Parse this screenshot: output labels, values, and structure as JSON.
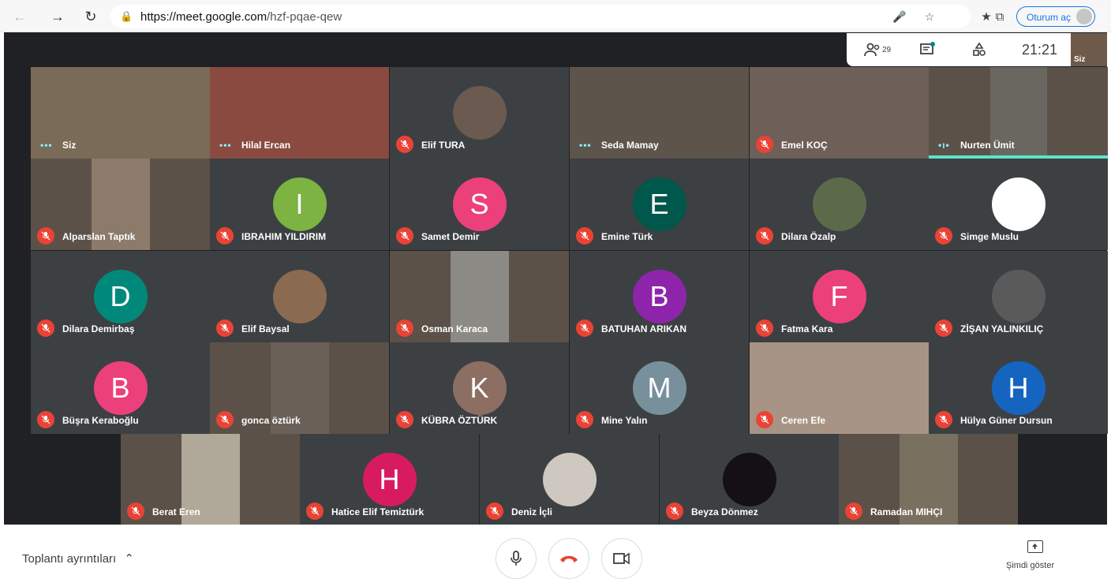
{
  "browser": {
    "url_host": "https://meet.google.com",
    "url_path": "/hzf-pqae-qew",
    "signin_label": "Oturum aç"
  },
  "meet_topbar": {
    "participant_count": "29",
    "time": "21:21",
    "self_label": "Siz"
  },
  "tiles": [
    {
      "name": "Siz",
      "type": "video",
      "status": "dots",
      "color": "#7a6a58"
    },
    {
      "name": "Hilal Ercan",
      "type": "video",
      "status": "dots",
      "color": "#8a4a40"
    },
    {
      "name": "Elif TURA",
      "type": "photo-avatar",
      "status": "muted",
      "color": "#6a5a50"
    },
    {
      "name": "Seda Mamay",
      "type": "video",
      "status": "dots",
      "color": "#5d544c"
    },
    {
      "name": "Emel KOÇ",
      "type": "video",
      "status": "muted",
      "color": "#6e6058"
    },
    {
      "name": "Nurten Ümit",
      "type": "video",
      "status": "speaking",
      "color": "#6a6660"
    },
    {
      "name": "Alparslan Taptık",
      "type": "video",
      "status": "muted",
      "color": "#8c7b6b"
    },
    {
      "name": "IBRAHIM YILDIRIM",
      "type": "letter",
      "letter": "I",
      "status": "muted",
      "color": "#7cb342"
    },
    {
      "name": "Samet Demir",
      "type": "letter",
      "letter": "S",
      "status": "muted",
      "color": "#ec407a"
    },
    {
      "name": "Emine Türk",
      "type": "letter",
      "letter": "E",
      "status": "muted",
      "color": "#00574b"
    },
    {
      "name": "Dilara Özalp",
      "type": "photo-avatar",
      "status": "muted",
      "color": "#5b6b4a"
    },
    {
      "name": "Simge Muslu",
      "type": "photo-avatar",
      "status": "muted",
      "color": "#ffffff"
    },
    {
      "name": "Dilara Demirbaş",
      "type": "letter",
      "letter": "D",
      "status": "muted",
      "color": "#00897b"
    },
    {
      "name": "Elif Baysal",
      "type": "photo-avatar",
      "status": "muted",
      "color": "#8a6a50"
    },
    {
      "name": "Osman Karaca",
      "type": "video",
      "status": "muted",
      "color": "#8b8a84"
    },
    {
      "name": "BATUHAN ARIKAN",
      "type": "letter",
      "letter": "B",
      "status": "muted",
      "color": "#8e24aa"
    },
    {
      "name": "Fatma Kara",
      "type": "letter",
      "letter": "F",
      "status": "muted",
      "color": "#ec407a"
    },
    {
      "name": "ZİŞAN YALINKILIÇ",
      "type": "photo-avatar",
      "status": "muted",
      "color": "#5a5a5a"
    },
    {
      "name": "Büşra Keraboğlu",
      "type": "letter",
      "letter": "B",
      "status": "muted",
      "color": "#ec407a"
    },
    {
      "name": "gonca öztürk",
      "type": "video",
      "status": "muted",
      "color": "#6b6058"
    },
    {
      "name": "KÜBRA ÖZTÜRK",
      "type": "letter",
      "letter": "K",
      "status": "muted",
      "color": "#8d6e63"
    },
    {
      "name": "Mine Yalın",
      "type": "letter",
      "letter": "M",
      "status": "muted",
      "color": "#78909c"
    },
    {
      "name": "Ceren Efe",
      "type": "video",
      "status": "muted",
      "color": "#a89484"
    },
    {
      "name": "Hülya Güner Dursun",
      "type": "letter",
      "letter": "H",
      "status": "muted",
      "color": "#1565c0"
    },
    {
      "name": "Berat Eren",
      "type": "video",
      "status": "muted",
      "color": "#b0a898"
    },
    {
      "name": "Hatice Elif Temiztürk",
      "type": "letter",
      "letter": "H",
      "status": "muted",
      "color": "#d81b60"
    },
    {
      "name": "Deniz İçli",
      "type": "photo-avatar",
      "status": "muted",
      "color": "#cfc8c0"
    },
    {
      "name": "Beyza Dönmez",
      "type": "photo-avatar",
      "status": "muted",
      "color": "#151015"
    },
    {
      "name": "Ramadan MIHÇI",
      "type": "video",
      "status": "muted",
      "color": "#7a7060"
    }
  ],
  "bottom_bar": {
    "details_label": "Toplantı ayrıntıları",
    "present_label": "Şimdi göster"
  },
  "colors": {
    "meet_bg": "#202124",
    "tile_bg": "#3c4043",
    "mute_red": "#ea4335",
    "end_call_red": "#ea4335",
    "speaking": "#5de3c8"
  }
}
